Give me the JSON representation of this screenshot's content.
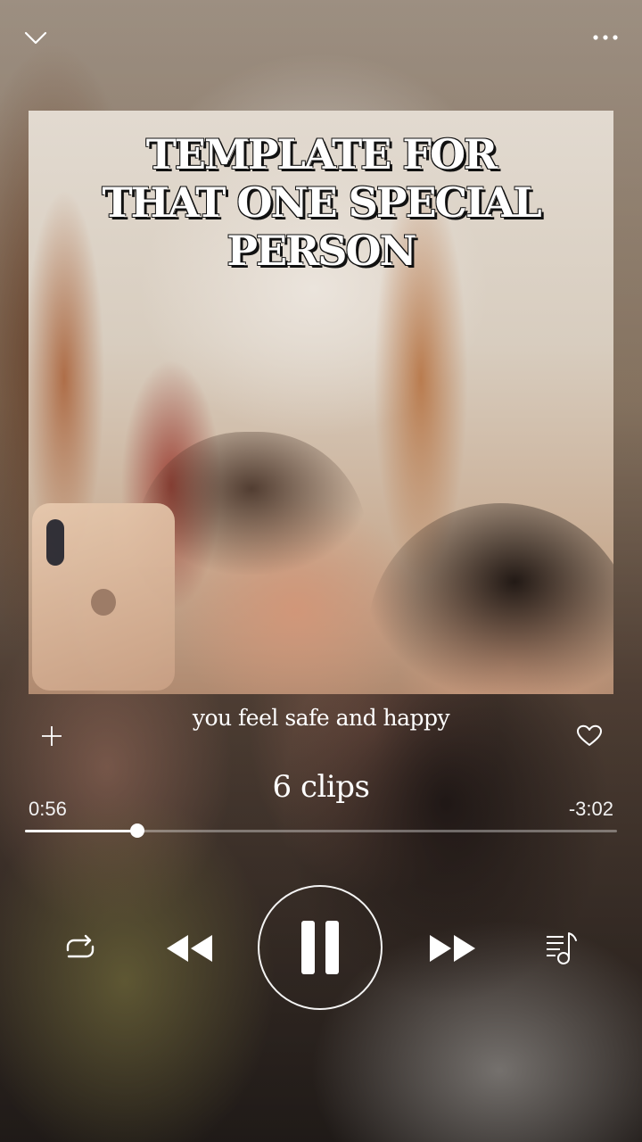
{
  "album": {
    "title": "TEMPLATE FOR THAT ONE SPECIAL PERSON"
  },
  "song": {
    "title": "you feel safe and happy",
    "subtitle": "6 clips"
  },
  "progress": {
    "elapsed": "0:56",
    "remaining": "-3:02",
    "fraction": 0.19
  },
  "icons": {
    "collapse": "chevron-down-icon",
    "more": "more-dots-icon",
    "add": "plus-icon",
    "like": "heart-icon",
    "repeat": "repeat-icon",
    "previous": "rewind-icon",
    "play_state": "pause-icon",
    "next": "fast-forward-icon",
    "queue": "queue-music-icon"
  },
  "colors": {
    "foreground": "#ffffff",
    "track": "#ffffff"
  }
}
